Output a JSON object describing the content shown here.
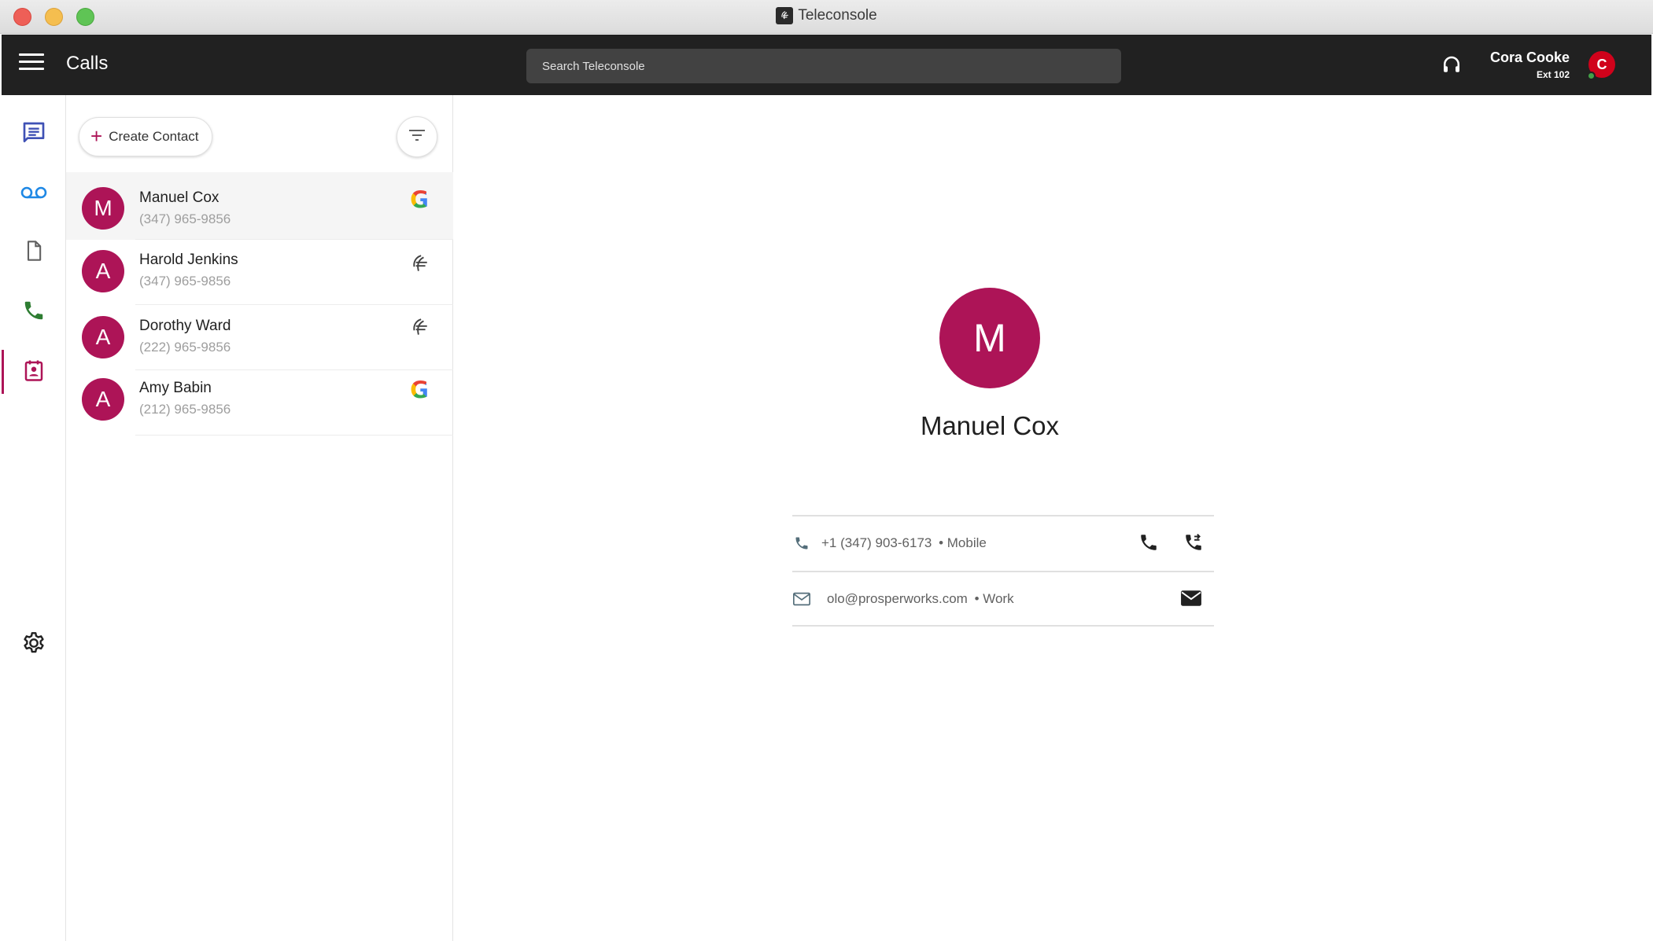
{
  "window": {
    "title": "Teleconsole"
  },
  "appbar": {
    "title": "Calls",
    "search_placeholder": "Search Teleconsole",
    "user": {
      "name": "Cora Cooke",
      "ext": "Ext 102",
      "initial": "C"
    }
  },
  "rail": {
    "items": [
      {
        "name": "messages",
        "icon": "message-icon"
      },
      {
        "name": "voicemail",
        "icon": "voicemail-icon"
      },
      {
        "name": "files",
        "icon": "file-icon"
      },
      {
        "name": "calls",
        "icon": "phone-icon"
      },
      {
        "name": "contacts",
        "icon": "contacts-icon",
        "active": true
      }
    ],
    "settings_icon": "gear-icon"
  },
  "contacts": {
    "create_label": "Create Contact",
    "list": [
      {
        "initial": "M",
        "name": "Manuel Cox",
        "phone": "(347) 965-9856",
        "source": "google"
      },
      {
        "initial": "A",
        "name": "Harold Jenkins",
        "phone": "(347) 965-9856",
        "source": "teleconsole"
      },
      {
        "initial": "A",
        "name": "Dorothy Ward",
        "phone": "(222) 965-9856",
        "source": "teleconsole"
      },
      {
        "initial": "A",
        "name": "Amy Babin",
        "phone": "(212) 965-9856",
        "source": "google"
      }
    ]
  },
  "detail": {
    "initial": "M",
    "name": "Manuel Cox",
    "phone": {
      "number": "+1 (347) 903-6173",
      "type": "• Mobile"
    },
    "email": {
      "address": "olo@prosperworks.com",
      "type": "• Work"
    }
  },
  "colors": {
    "accent": "#ad1457",
    "appbar_bg": "#212121",
    "search_bg": "#424242",
    "user_avatar": "#d0021b",
    "rail_messages": "#3f51b5",
    "rail_voicemail": "#1e88e5",
    "rail_calls": "#2e7d32"
  }
}
